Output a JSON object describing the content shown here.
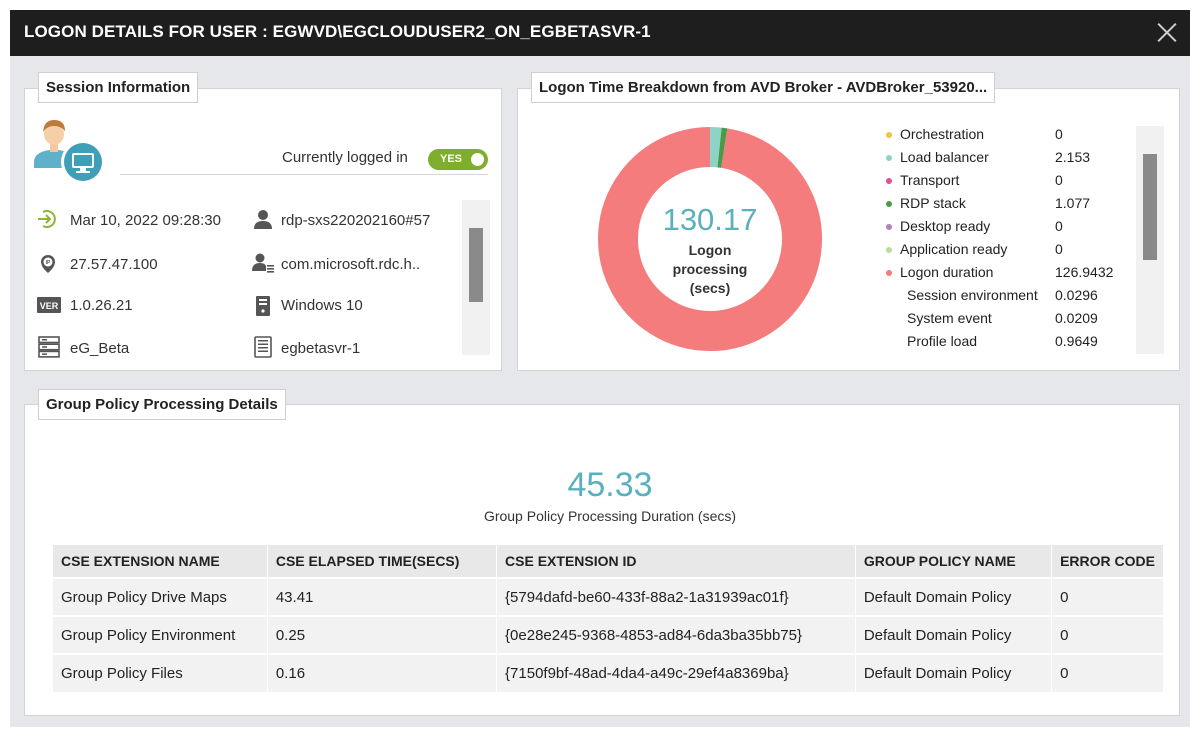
{
  "dialog": {
    "title": "LOGON DETAILS FOR USER : EGWVD\\EGCLOUDUSER2_ON_EGBETASVR-1"
  },
  "session": {
    "label": "Session Information",
    "logged_in_label": "Currently logged in",
    "logged_in_value": "YES",
    "logon_time": "Mar 10, 2022 09:28:30",
    "session_name": "rdp-sxs220202160#57",
    "ip": "27.57.47.100",
    "client": "com.microsoft.rdc.h..",
    "version": "1.0.26.21",
    "os": "Windows 10",
    "server_group": "eG_Beta",
    "host": "egbetasvr-1"
  },
  "breakdown": {
    "label": "Logon Time Breakdown from AVD Broker - AVDBroker_53920...",
    "total": "130.17",
    "center_label_line1": "Logon",
    "center_label_line2": "processing",
    "center_label_line3": "(secs)",
    "legend": [
      {
        "name": "Orchestration",
        "value": "0",
        "color": "#f6c142",
        "sub": false
      },
      {
        "name": "Load balancer",
        "value": "2.153",
        "color": "#8fd3c6",
        "sub": false
      },
      {
        "name": "Transport",
        "value": "0",
        "color": "#e34d9a",
        "sub": false
      },
      {
        "name": "RDP stack",
        "value": "1.077",
        "color": "#4b9a46",
        "sub": false
      },
      {
        "name": "Desktop ready",
        "value": "0",
        "color": "#b57fc0",
        "sub": false
      },
      {
        "name": "Application ready",
        "value": "0",
        "color": "#b9dc9b",
        "sub": false
      },
      {
        "name": "Logon duration",
        "value": "126.9432",
        "color": "#f47c7c",
        "sub": false
      },
      {
        "name": "Session environment",
        "value": "0.0296",
        "color": "",
        "sub": true
      },
      {
        "name": "System event",
        "value": "0.0209",
        "color": "",
        "sub": true
      },
      {
        "name": "Profile load",
        "value": "0.9649",
        "color": "",
        "sub": true
      }
    ]
  },
  "chart_data": {
    "type": "pie",
    "categories": [
      "Orchestration",
      "Load balancer",
      "Transport",
      "RDP stack",
      "Desktop ready",
      "Application ready",
      "Logon duration"
    ],
    "values": [
      0,
      2.153,
      0,
      1.077,
      0,
      0,
      126.9432
    ],
    "colors": [
      "#f6c142",
      "#8fd3c6",
      "#e34d9a",
      "#4b9a46",
      "#b57fc0",
      "#b9dc9b",
      "#f47c7c"
    ]
  },
  "group_policy": {
    "label": "Group Policy Processing Details",
    "duration": "45.33",
    "duration_label": "Group Policy Processing Duration (secs)",
    "columns": [
      "CSE EXTENSION NAME",
      "CSE ELAPSED TIME(SECS)",
      "CSE EXTENSION ID",
      "GROUP POLICY NAME",
      "ERROR CODE"
    ],
    "rows": [
      [
        "Group Policy Drive Maps",
        "43.41",
        "{5794dafd-be60-433f-88a2-1a31939ac01f}",
        "Default Domain Policy",
        "0"
      ],
      [
        "Group Policy Environment",
        "0.25",
        "{0e28e245-9368-4853-ad84-6da3ba35bb75}",
        "Default Domain Policy",
        "0"
      ],
      [
        "Group Policy Files",
        "0.16",
        "{7150f9bf-48ad-4da4-a49c-29ef4a8369ba}",
        "Default Domain Policy",
        "0"
      ]
    ]
  },
  "icons": {
    "close": "close-icon",
    "avatar": "user-desktop-icon",
    "logon_time": "login-arrow-icon",
    "session_name": "user-icon",
    "ip": "ip-pin-icon",
    "client": "user-list-icon",
    "version": "ver-badge-icon",
    "os": "pc-tower-icon",
    "server_group": "server-stack-icon",
    "host": "server-icon"
  }
}
